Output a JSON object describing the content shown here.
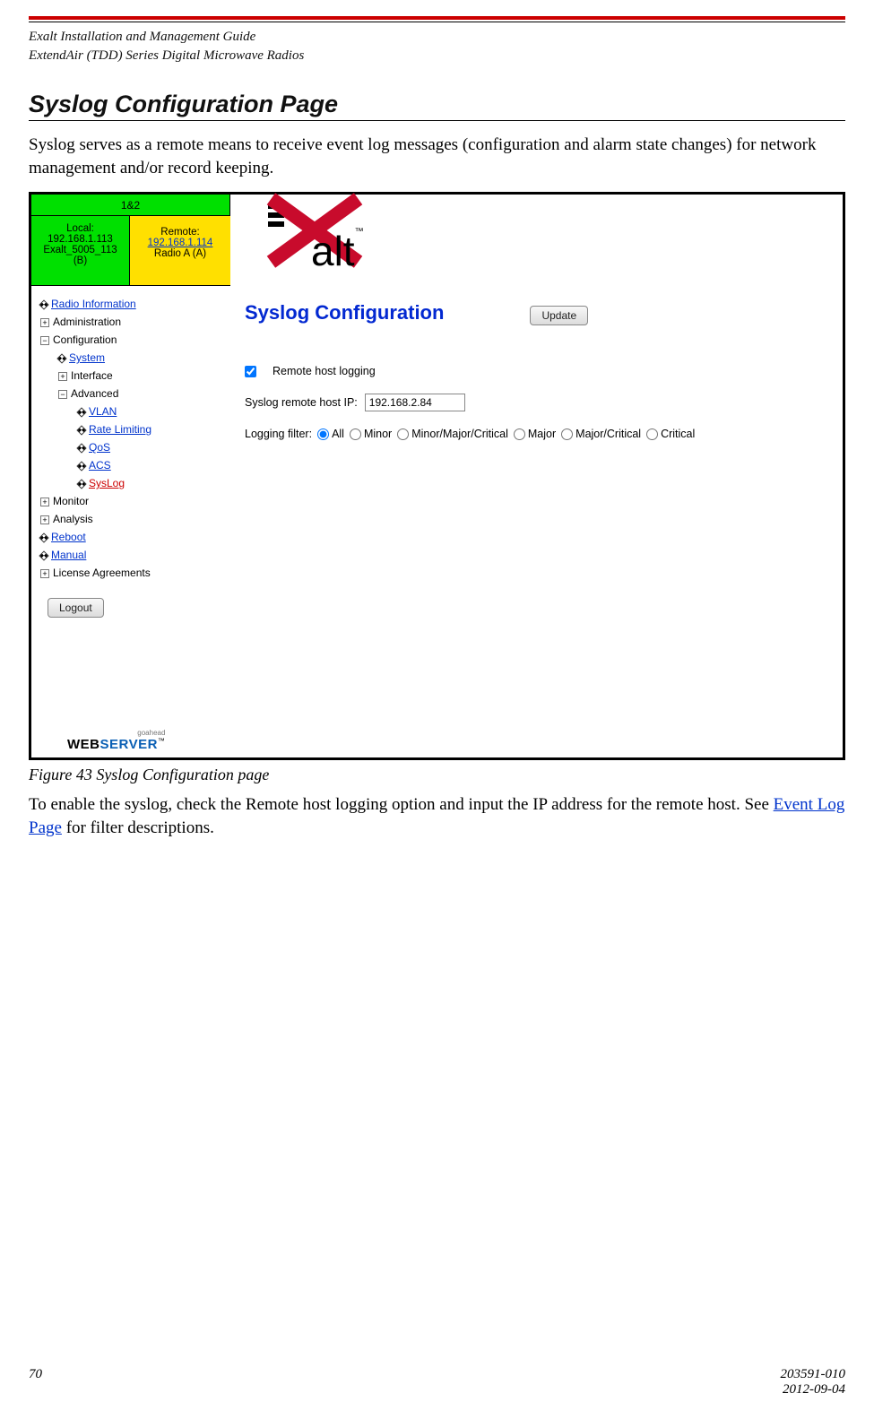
{
  "doc": {
    "header_line1": "Exalt Installation and Management Guide",
    "header_line2": "ExtendAir (TDD) Series Digital Microwave Radios",
    "section_title": "Syslog Configuration Page",
    "intro": "Syslog serves as a remote means to receive event log messages (configuration and alarm state changes) for network management and/or record keeping.",
    "figure_caption": "Figure 43   Syslog Configuration page",
    "after_fig_pre": "To enable the syslog, check the Remote host logging option and input the IP address for the remote host. See ",
    "after_fig_link": "Event Log Page",
    "after_fig_post": " for filter descriptions.",
    "page_number": "70",
    "doc_id": "203591-010",
    "doc_date": "2012-09-04"
  },
  "sidebar": {
    "tab_1and2": "1&2",
    "local_label": "Local:",
    "local_ip": "192.168.1.113",
    "local_name": "Exalt_5005_113",
    "local_suffix": "(B)",
    "remote_label": "Remote:",
    "remote_ip": "192.168.1.114",
    "remote_name": "Radio A (A)",
    "radio_info": "Radio Information",
    "administration": "Administration",
    "configuration": "Configuration",
    "system": "System",
    "interface": "Interface",
    "advanced": "Advanced",
    "vlan": "VLAN",
    "rate_limiting": "Rate Limiting",
    "qos": "QoS",
    "acs": "ACS",
    "syslog": "SysLog",
    "monitor": "Monitor",
    "analysis": "Analysis",
    "reboot": "Reboot",
    "manual": "Manual",
    "license": "License Agreements",
    "logout": "Logout",
    "goahead": "goahead",
    "web": "WEB",
    "server": "SERVER"
  },
  "panel": {
    "title": "Syslog Configuration",
    "update_btn": "Update",
    "remote_host_logging": "Remote host logging",
    "remote_host_ip_label": "Syslog remote host IP:",
    "remote_host_ip_value": "192.168.2.84",
    "filter_label": "Logging filter:",
    "filters": {
      "all": "All",
      "minor": "Minor",
      "minor_major_critical": "Minor/Major/Critical",
      "major": "Major",
      "major_critical": "Major/Critical",
      "critical": "Critical"
    },
    "logo_text": "alt",
    "tm": "™"
  }
}
